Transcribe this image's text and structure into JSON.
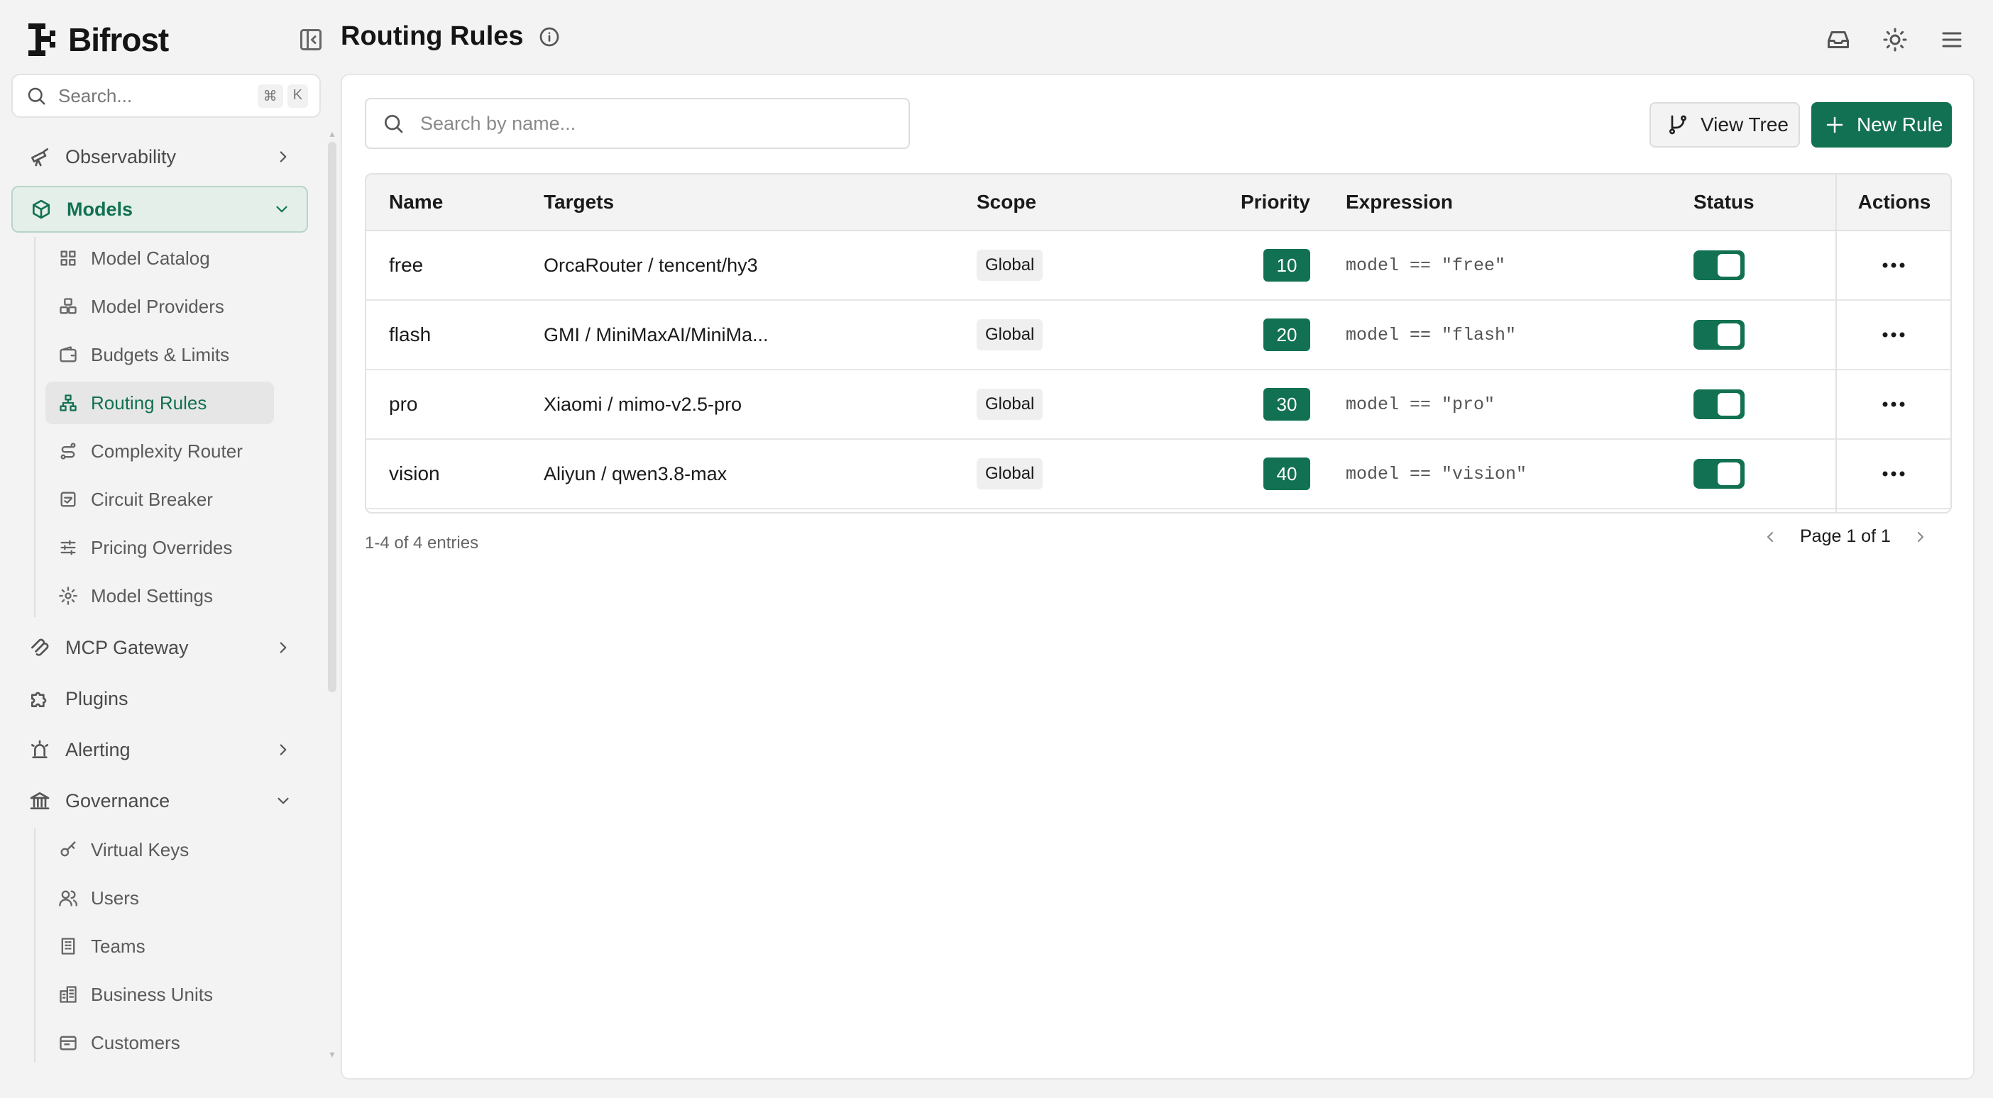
{
  "app": {
    "name": "Bifrost"
  },
  "sidebar": {
    "search": {
      "placeholder": "Search...",
      "shortcut": [
        "⌘",
        "K"
      ]
    },
    "items": [
      {
        "label": "Observability",
        "icon": "telescope-icon",
        "expanded": false
      },
      {
        "label": "Models",
        "icon": "cube-icon",
        "expanded": true,
        "active": true,
        "children": [
          {
            "label": "Model Catalog",
            "icon": "grid-icon"
          },
          {
            "label": "Model Providers",
            "icon": "boxes-icon"
          },
          {
            "label": "Budgets & Limits",
            "icon": "wallet-icon"
          },
          {
            "label": "Routing Rules",
            "icon": "network-icon",
            "active": true
          },
          {
            "label": "Complexity Router",
            "icon": "route-icon"
          },
          {
            "label": "Circuit Breaker",
            "icon": "breaker-icon"
          },
          {
            "label": "Pricing Overrides",
            "icon": "sliders-icon"
          },
          {
            "label": "Model Settings",
            "icon": "gear-icon"
          }
        ]
      },
      {
        "label": "MCP Gateway",
        "icon": "mcp-icon",
        "expanded": false
      },
      {
        "label": "Plugins",
        "icon": "puzzle-icon"
      },
      {
        "label": "Alerting",
        "icon": "siren-icon",
        "expanded": false
      },
      {
        "label": "Governance",
        "icon": "landmark-icon",
        "expanded": true,
        "children": [
          {
            "label": "Virtual Keys",
            "icon": "key-icon"
          },
          {
            "label": "Users",
            "icon": "users-icon"
          },
          {
            "label": "Teams",
            "icon": "building-icon"
          },
          {
            "label": "Business Units",
            "icon": "buildings-icon"
          },
          {
            "label": "Customers",
            "icon": "customers-icon"
          }
        ]
      }
    ]
  },
  "header": {
    "title": "Routing Rules"
  },
  "main": {
    "search": {
      "placeholder": "Search by name..."
    },
    "buttons": {
      "view_tree": "View Tree",
      "new_rule": "New Rule"
    },
    "columns": {
      "name": "Name",
      "targets": "Targets",
      "scope": "Scope",
      "priority": "Priority",
      "expression": "Expression",
      "status": "Status",
      "actions": "Actions"
    },
    "rows": [
      {
        "name": "free",
        "targets": "OrcaRouter / tencent/hy3",
        "scope": "Global",
        "priority": "10",
        "expression": "model == \"free\"",
        "enabled": true
      },
      {
        "name": "flash",
        "targets": "GMI / MiniMaxAI/MiniMa...",
        "scope": "Global",
        "priority": "20",
        "expression": "model == \"flash\"",
        "enabled": true
      },
      {
        "name": "pro",
        "targets": "Xiaomi / mimo-v2.5-pro",
        "scope": "Global",
        "priority": "30",
        "expression": "model == \"pro\"",
        "enabled": true
      },
      {
        "name": "vision",
        "targets": "Aliyun / qwen3.8-max",
        "scope": "Global",
        "priority": "40",
        "expression": "model == \"vision\"",
        "enabled": true
      }
    ],
    "entries_text": "1-4 of 4 entries",
    "pagination": "Page 1 of 1"
  },
  "colors": {
    "accent": "#127152",
    "background": "#f3f3f3",
    "panel": "#ffffff"
  }
}
